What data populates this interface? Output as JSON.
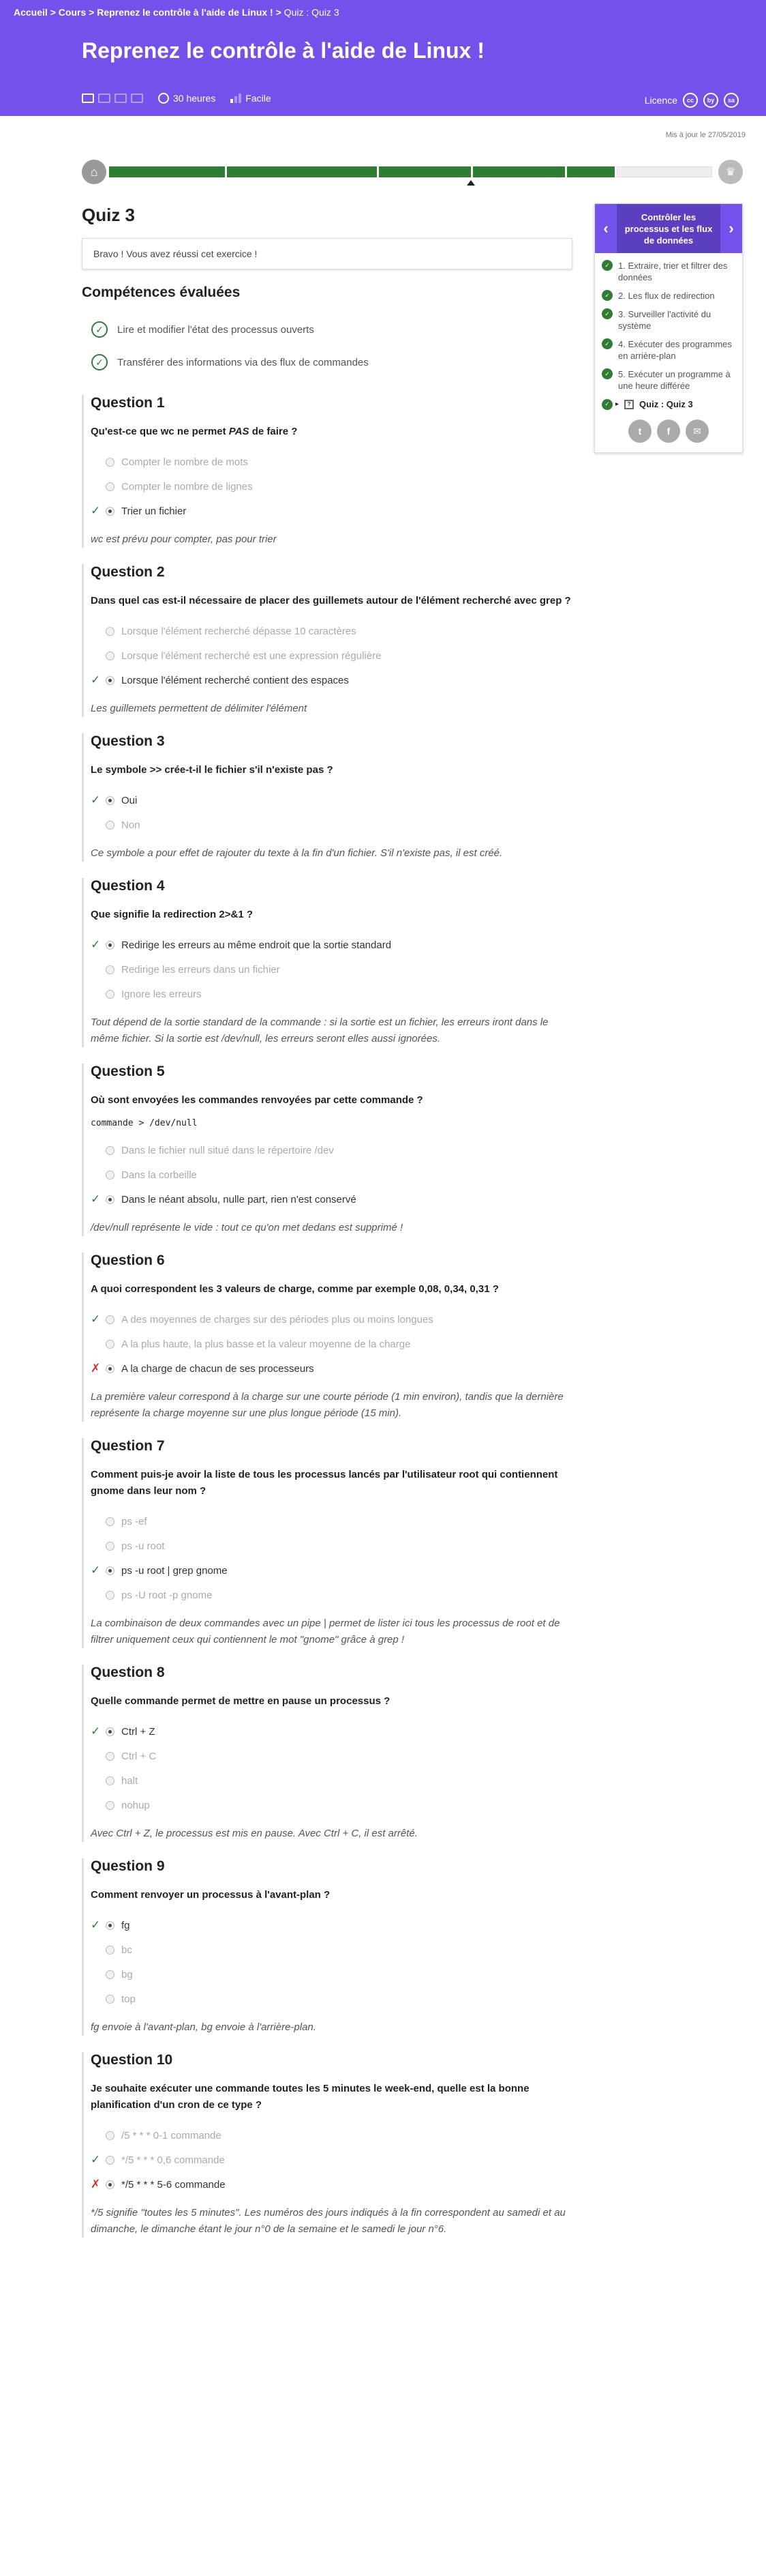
{
  "breadcrumb": {
    "home": "Accueil",
    "sep1": ">",
    "cours": "Cours",
    "sep2": ">",
    "course": "Reprenez le contrôle à l'aide de Linux !",
    "sep3": ">",
    "current": "Quiz : Quiz 3"
  },
  "header": {
    "title": "Reprenez le contrôle à l'aide de Linux !",
    "duration": "30 heures",
    "level": "Facile",
    "licence": "Licence",
    "cc_icons": [
      "cc",
      "by",
      "sa"
    ]
  },
  "updated": "Mis à jour le 27/05/2019",
  "progress": {
    "segments": [
      {
        "done": true
      },
      {
        "done": true
      },
      {
        "done": true
      },
      {
        "done": true
      },
      {
        "done": true
      },
      {
        "done": false
      }
    ]
  },
  "quiz": {
    "title": "Quiz 3",
    "bravo": "Bravo ! Vous avez réussi cet exercice !",
    "competences_title": "Compétences évaluées",
    "competences": [
      "Lire et modifier l'état des processus ouverts",
      "Transférer des informations via des flux de commandes"
    ],
    "questions": [
      {
        "title": "Question 1",
        "prompt_pre": "Qu'est-ce que wc ne permet ",
        "prompt_em": "PAS",
        "prompt_post": " de faire ?",
        "code": "",
        "answers": [
          {
            "text": "Compter le nombre de mots",
            "mark": "",
            "selected": false
          },
          {
            "text": "Compter le nombre de lignes",
            "mark": "",
            "selected": false
          },
          {
            "text": "Trier un fichier",
            "mark": "ok",
            "selected": true
          }
        ],
        "explanation": "wc est prévu pour compter, pas pour trier"
      },
      {
        "title": "Question 2",
        "prompt_pre": "Dans quel cas est-il nécessaire de placer des guillemets autour de l'élément recherché avec grep ?",
        "prompt_em": "",
        "prompt_post": "",
        "code": "",
        "answers": [
          {
            "text": "Lorsque l'élément recherché dépasse 10 caractères",
            "mark": "",
            "selected": false
          },
          {
            "text": "Lorsque l'élément recherché est une expression régulière",
            "mark": "",
            "selected": false
          },
          {
            "text": "Lorsque l'élément recherché contient des espaces",
            "mark": "ok",
            "selected": true
          }
        ],
        "explanation": "Les guillemets permettent de délimiter l'élément"
      },
      {
        "title": "Question 3",
        "prompt_pre": "Le symbole >> crée-t-il le fichier s'il n'existe pas ?",
        "prompt_em": "",
        "prompt_post": "",
        "code": "",
        "answers": [
          {
            "text": "Oui",
            "mark": "ok",
            "selected": true
          },
          {
            "text": "Non",
            "mark": "",
            "selected": false
          }
        ],
        "explanation": "Ce symbole a pour effet de rajouter du texte à la fin d'un fichier. S'il n'existe pas, il est créé."
      },
      {
        "title": "Question 4",
        "prompt_pre": "Que signifie la redirection 2>&1 ?",
        "prompt_em": "",
        "prompt_post": "",
        "code": "",
        "answers": [
          {
            "text": "Redirige les erreurs au même endroit que la sortie standard",
            "mark": "ok",
            "selected": true
          },
          {
            "text": "Redirige les erreurs dans un fichier",
            "mark": "",
            "selected": false
          },
          {
            "text": "Ignore les erreurs",
            "mark": "",
            "selected": false
          }
        ],
        "explanation": "Tout dépend de la sortie standard de la commande : si la sortie est un fichier, les erreurs iront dans le même fichier. Si la sortie est /dev/null, les erreurs seront elles aussi ignorées."
      },
      {
        "title": "Question 5",
        "prompt_pre": "Où sont envoyées les commandes renvoyées par cette commande ?",
        "prompt_em": "",
        "prompt_post": "",
        "code": "commande > /dev/null",
        "answers": [
          {
            "text": "Dans le fichier null situé dans le répertoire /dev",
            "mark": "",
            "selected": false
          },
          {
            "text": "Dans la corbeille",
            "mark": "",
            "selected": false
          },
          {
            "text": "Dans le néant absolu, nulle part, rien n'est conservé",
            "mark": "ok",
            "selected": true
          }
        ],
        "explanation": "/dev/null représente le vide : tout ce qu'on met dedans est supprimé !"
      },
      {
        "title": "Question 6",
        "prompt_pre": "A quoi correspondent les 3 valeurs de charge, comme par exemple 0,08, 0,34, 0,31 ?",
        "prompt_em": "",
        "prompt_post": "",
        "code": "",
        "answers": [
          {
            "text": "A des moyennes de charges sur des périodes plus ou moins longues",
            "mark": "ok",
            "selected": false
          },
          {
            "text": "A la plus haute, la plus basse et la valeur moyenne de la charge",
            "mark": "",
            "selected": false
          },
          {
            "text": "A la charge de chacun de ses processeurs",
            "mark": "ko",
            "selected": true
          }
        ],
        "explanation": "La première valeur correspond à la charge sur une courte période (1 min environ), tandis que la dernière représente la charge moyenne sur une plus longue période (15 min)."
      },
      {
        "title": "Question 7",
        "prompt_pre": "Comment puis-je avoir la liste de tous les processus lancés par l'utilisateur root qui contiennent gnome dans leur nom ?",
        "prompt_em": "",
        "prompt_post": "",
        "code": "",
        "answers": [
          {
            "text": "ps -ef",
            "mark": "",
            "selected": false
          },
          {
            "text": "ps -u root",
            "mark": "",
            "selected": false
          },
          {
            "text": "ps -u root | grep gnome",
            "mark": "ok",
            "selected": true
          },
          {
            "text": "ps -U root -p gnome",
            "mark": "",
            "selected": false
          }
        ],
        "explanation": "La combinaison de deux commandes avec un pipe | permet de lister ici tous les processus de root et de filtrer uniquement ceux qui contiennent le mot \"gnome\" grâce à grep !"
      },
      {
        "title": "Question 8",
        "prompt_pre": "Quelle commande permet de mettre en pause un processus ?",
        "prompt_em": "",
        "prompt_post": "",
        "code": "",
        "answers": [
          {
            "text": "Ctrl + Z",
            "mark": "ok",
            "selected": true
          },
          {
            "text": "Ctrl + C",
            "mark": "",
            "selected": false
          },
          {
            "text": "halt",
            "mark": "",
            "selected": false
          },
          {
            "text": "nohup",
            "mark": "",
            "selected": false
          }
        ],
        "explanation": "Avec Ctrl + Z, le processus est mis en pause. Avec Ctrl + C, il est arrêté."
      },
      {
        "title": "Question 9",
        "prompt_pre": "Comment renvoyer un processus à l'avant-plan ?",
        "prompt_em": "",
        "prompt_post": "",
        "code": "",
        "answers": [
          {
            "text": "fg",
            "mark": "ok",
            "selected": true
          },
          {
            "text": "bc",
            "mark": "",
            "selected": false
          },
          {
            "text": "bg",
            "mark": "",
            "selected": false
          },
          {
            "text": "top",
            "mark": "",
            "selected": false
          }
        ],
        "explanation": "fg envoie à l'avant-plan, bg envoie à l'arrière-plan."
      },
      {
        "title": "Question 10",
        "prompt_pre": " Je souhaite exécuter une commande toutes les 5 minutes le week-end, quelle est la bonne planification d'un cron de ce type ?",
        "prompt_em": "",
        "prompt_post": "",
        "code": "",
        "answers": [
          {
            "text": "/5 * * * 0-1 commande",
            "mark": "",
            "selected": false
          },
          {
            "text": "*/5 * * * 0,6 commande",
            "mark": "ok",
            "selected": false
          },
          {
            "text": "*/5 * * * 5-6 commande",
            "mark": "ko",
            "selected": true
          }
        ],
        "explanation": "*/5 signifie \"toutes les 5 minutes\". Les numéros des jours indiqués à la fin correspondent au samedi et au dimanche, le dimanche étant le jour n°0 de la semaine et le samedi le jour n°6."
      }
    ]
  },
  "sidebar": {
    "title": "Contrôler les processus et les flux de données",
    "prev": "‹",
    "next": "›",
    "items": [
      {
        "label": "1. Extraire, trier et filtrer des données"
      },
      {
        "label": "2. Les flux de redirection"
      },
      {
        "label": "3. Surveiller l'activité du système"
      },
      {
        "label": "4. Exécuter des programmes en arrière-plan"
      },
      {
        "label": "5. Exécuter un programme à une heure différée"
      }
    ],
    "current": "Quiz : Quiz 3",
    "share": [
      "t",
      "f",
      "✉"
    ]
  }
}
